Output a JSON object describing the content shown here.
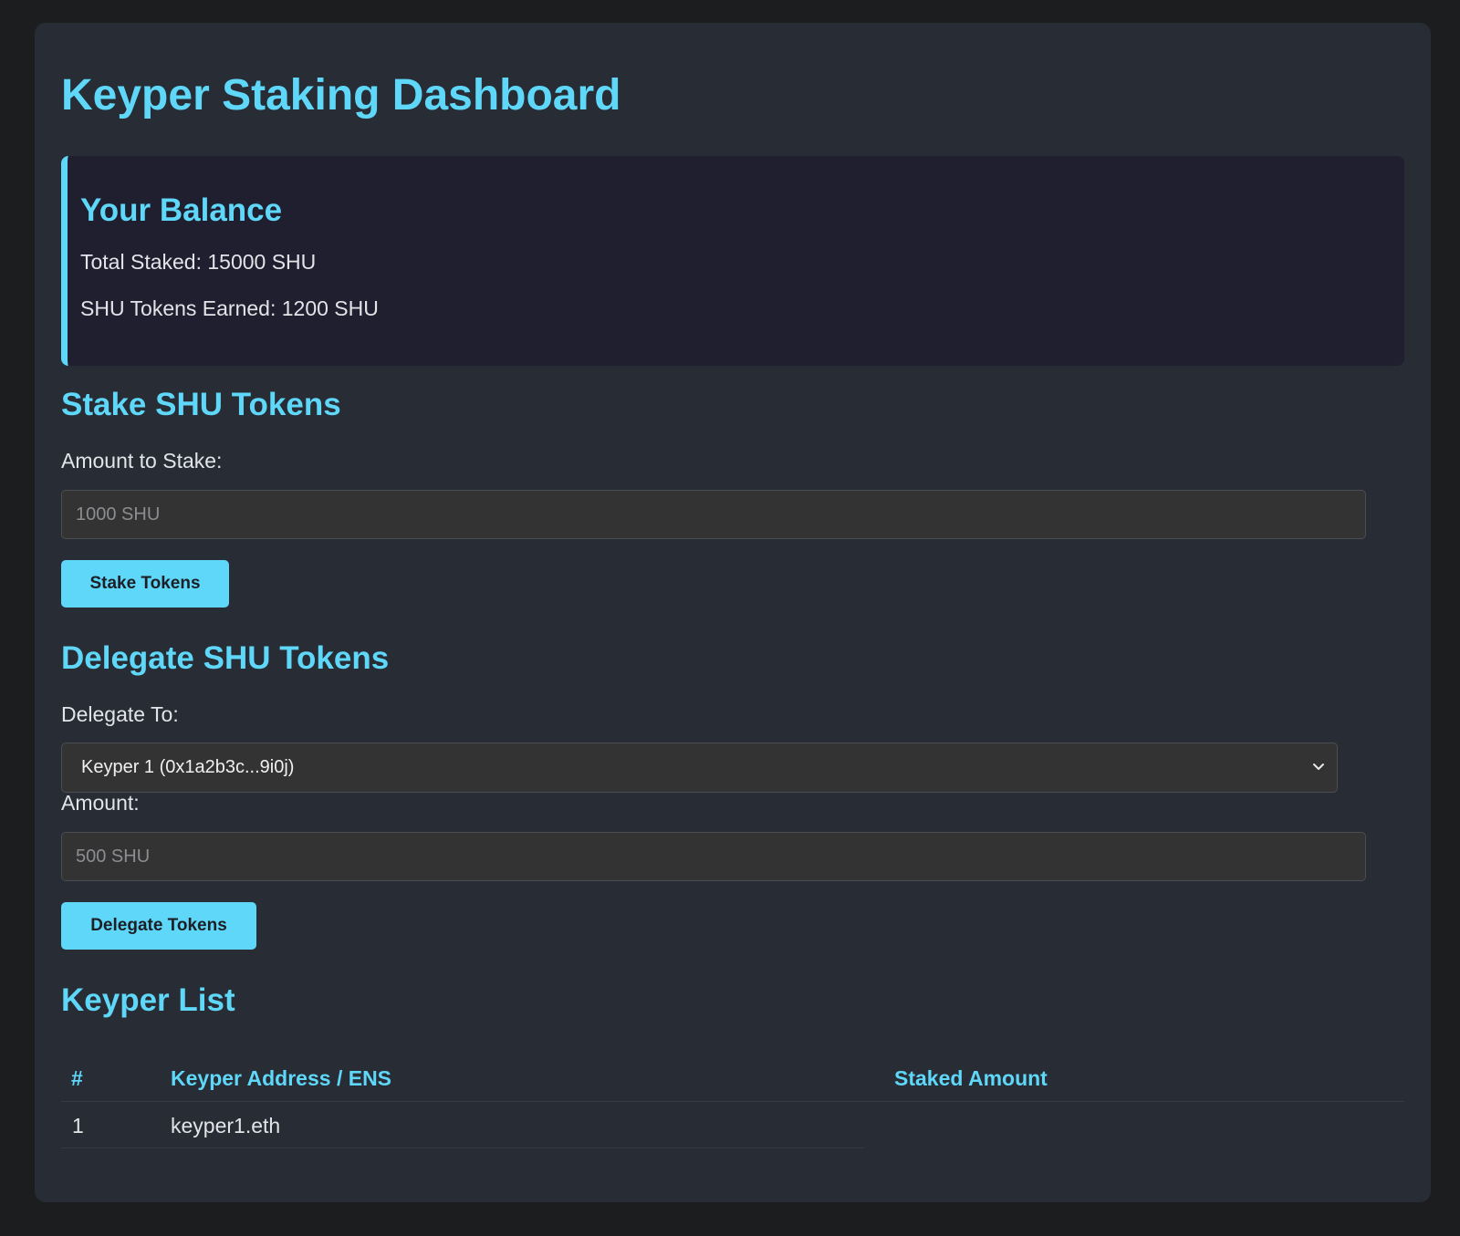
{
  "page": {
    "title": "Keyper Staking Dashboard"
  },
  "balance": {
    "title": "Your Balance",
    "total_staked": "Total Staked: 15000 SHU",
    "tokens_earned": "SHU Tokens Earned: 1200 SHU"
  },
  "stake": {
    "title": "Stake SHU Tokens",
    "amount_label": "Amount to Stake:",
    "amount_placeholder": "1000 SHU",
    "button_label": "Stake Tokens"
  },
  "delegate": {
    "title": "Delegate SHU Tokens",
    "delegate_to_label": "Delegate To:",
    "selected_keyper": "Keyper 1 (0x1a2b3c...9i0j)",
    "amount_label": "Amount:",
    "amount_placeholder": "500 SHU",
    "button_label": "Delegate Tokens"
  },
  "keyper_list": {
    "title": "Keyper List",
    "headers": [
      "#",
      "Keyper Address / ENS",
      "Staked Amount"
    ],
    "rows": [
      {
        "index": "1",
        "address": "keyper1.eth",
        "staked": ""
      }
    ]
  },
  "icons": {
    "select_chevron": "chevron-down-icon"
  },
  "colors": {
    "accent": "#5fd7f8",
    "page_background": "#1c1d1f",
    "panel_background": "#282c35",
    "card_background": "#1f1f30",
    "input_background": "#333333",
    "text": "#e2e4e8"
  }
}
